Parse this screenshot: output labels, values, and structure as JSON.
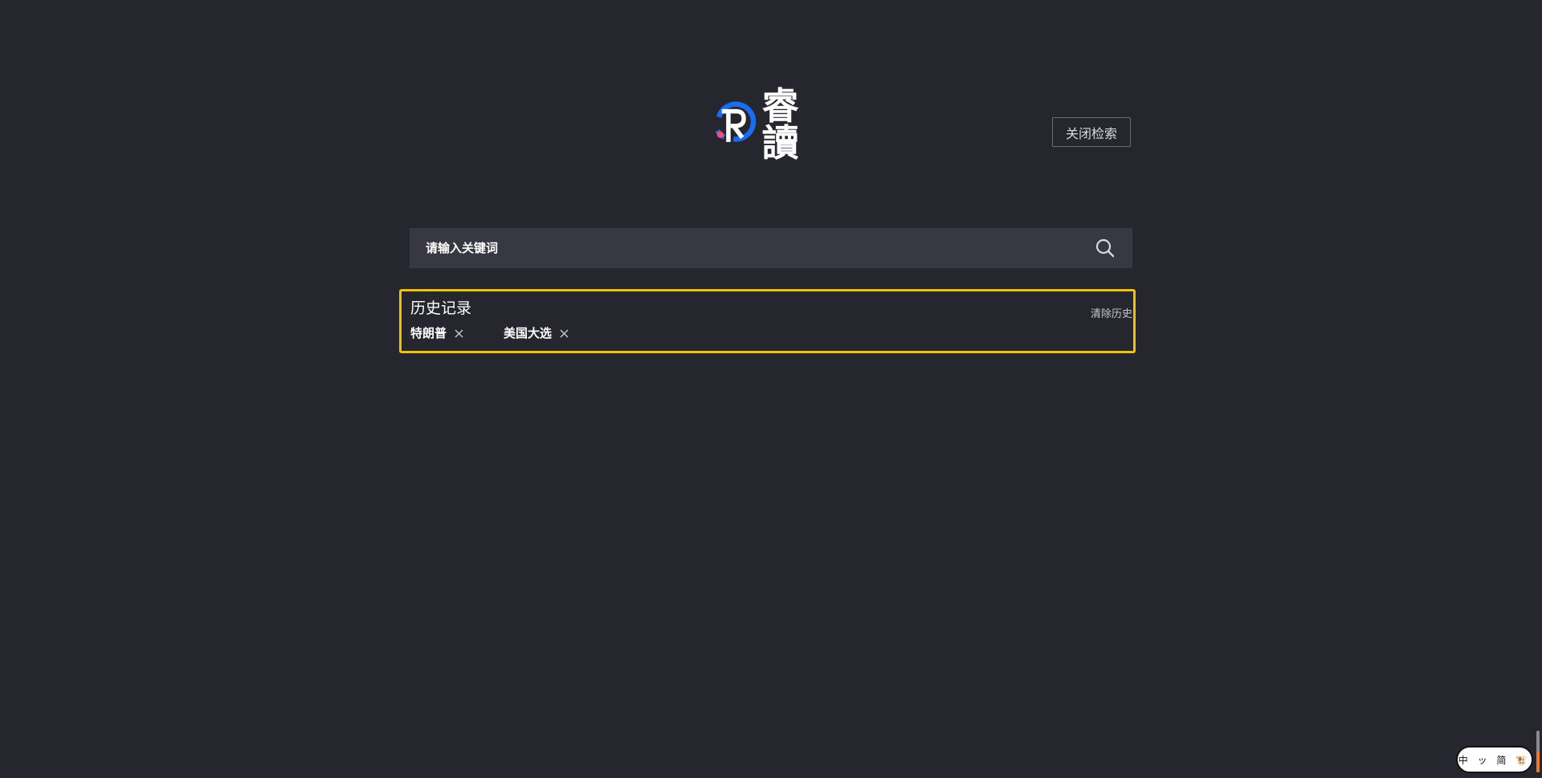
{
  "brand": {
    "logo_text": "睿讀",
    "colors": {
      "blue": "#1a6cf0",
      "pink": "#ff4d6d",
      "white": "#ffffff"
    }
  },
  "header": {
    "close_search_label": "关闭检索"
  },
  "search": {
    "placeholder": "请输入关键词",
    "value": "",
    "icon": "search-icon"
  },
  "history": {
    "title": "历史记录",
    "clear_label": "清除历史",
    "items": [
      {
        "label": "特朗普",
        "remove_icon": "close-icon"
      },
      {
        "label": "美国大选",
        "remove_icon": "close-icon"
      }
    ],
    "highlight_color": "#f2c100"
  },
  "widget": {
    "label": "中 ッ 简 🐮"
  },
  "theme": {
    "background": "#26262e",
    "search_background": "#383842"
  }
}
